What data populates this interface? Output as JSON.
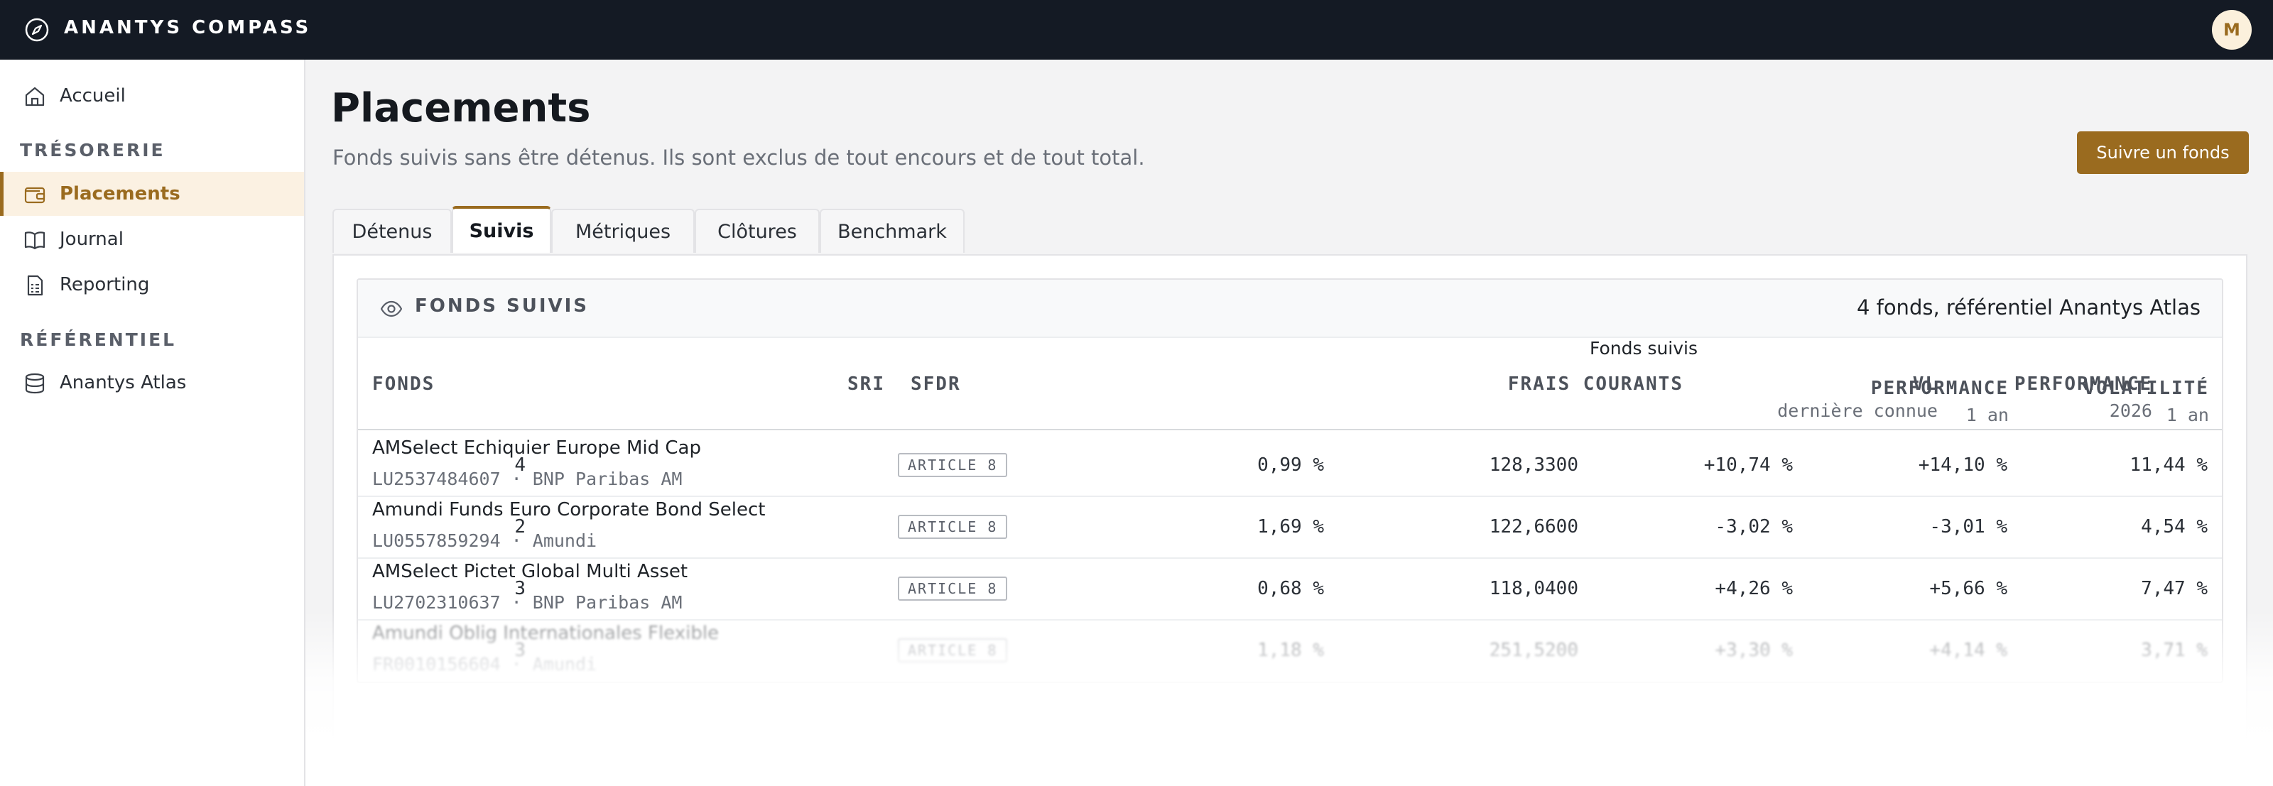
{
  "app": {
    "name": "ANANTYS COMPASS",
    "avatar_initial": "M",
    "accent": "#9a6b1f",
    "topbar_bg": "#141a24"
  },
  "sidebar": {
    "home": {
      "label": "Accueil",
      "icon": "home-icon"
    },
    "section_tresorerie": "TRÉSORERIE",
    "items_tresorerie": [
      {
        "label": "Placements",
        "icon": "wallet-icon",
        "active": true
      },
      {
        "label": "Journal",
        "icon": "book-icon"
      },
      {
        "label": "Reporting",
        "icon": "report-icon"
      }
    ],
    "section_referentiel": "RÉFÉRENTIEL",
    "items_referentiel": [
      {
        "label": "Anantys Atlas",
        "icon": "database-icon"
      }
    ]
  },
  "page": {
    "title": "Placements",
    "subtitle": "Fonds suivis sans être détenus. Ils sont exclus de tout encours et de tout total.",
    "primary_button": "Suivre un fonds"
  },
  "tabs": [
    {
      "label": "Détenus"
    },
    {
      "label": "Suivis",
      "active": true
    },
    {
      "label": "Métriques"
    },
    {
      "label": "Clôtures"
    },
    {
      "label": "Benchmark"
    }
  ],
  "card": {
    "title": "FONDS SUIVIS",
    "meta": "4 fonds, référentiel Anantys Atlas",
    "group_label": "Fonds suivis",
    "columns": {
      "fonds": "FONDS",
      "sri": "SRI",
      "sfdr": "SFDR",
      "frais": "FRAIS COURANTS",
      "vl": "VL",
      "vl_sub": "dernière connue",
      "perf_ytd": "PERFORMANCE",
      "perf_ytd_sub": "2026",
      "perf_1y": "PERFORMANCE",
      "perf_1y_sub": "1 an",
      "vol": "VOLATILITÉ",
      "vol_sub": "1 an"
    },
    "rows": [
      {
        "name": "AMSelect Echiquier Europe Mid Cap",
        "sub": "LU2537484607 · BNP Paribas AM",
        "sri": "4",
        "sfdr": "ARTICLE 8",
        "frais": "0,99 %",
        "vl": "128,3300",
        "perf_ytd": "+10,74 %",
        "perf_1y": "+14,10 %",
        "vol": "11,44 %"
      },
      {
        "name": "Amundi Funds Euro Corporate Bond Select",
        "sub": "LU0557859294 · Amundi",
        "sri": "2",
        "sfdr": "ARTICLE 8",
        "frais": "1,69 %",
        "vl": "122,6600",
        "perf_ytd": "-3,02 %",
        "perf_1y": "-3,01 %",
        "vol": "4,54 %"
      },
      {
        "name": "AMSelect Pictet Global Multi Asset",
        "sub": "LU2702310637 · BNP Paribas AM",
        "sri": "3",
        "sfdr": "ARTICLE 8",
        "frais": "0,68 %",
        "vl": "118,0400",
        "perf_ytd": "+4,26 %",
        "perf_1y": "+5,66 %",
        "vol": "7,47 %"
      },
      {
        "name": "Amundi Oblig Internationales Flexible",
        "sub": "FR0010156604 · Amundi",
        "sri": "3",
        "sfdr": "ARTICLE 8",
        "frais": "1,18 %",
        "vl": "251,5200",
        "perf_ytd": "+3,30 %",
        "perf_1y": "+4,14 %",
        "vol": "3,71 %"
      }
    ]
  }
}
